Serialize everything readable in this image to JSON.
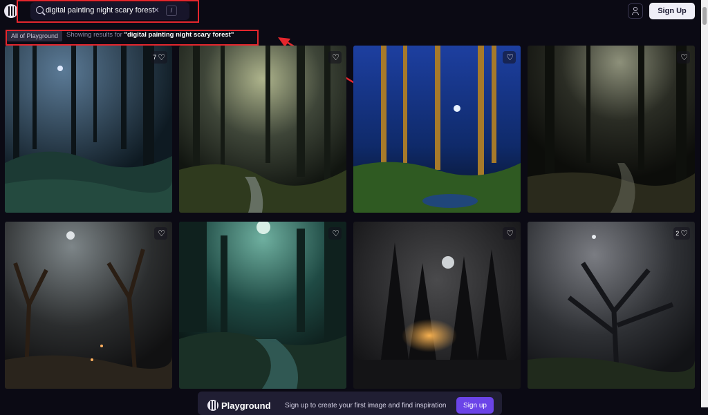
{
  "app": {
    "name": "Playground"
  },
  "search": {
    "query": "digital painting night scary forest",
    "shortcut": "/"
  },
  "header": {
    "signup_label": "Sign Up"
  },
  "filters": {
    "scope_chip": "All of Playground",
    "results_prefix": "Showing results for",
    "results_query": "\"digital painting night scary forest\""
  },
  "grid": {
    "cards": [
      {
        "likes": "7",
        "scene": "forest-moon-blue"
      },
      {
        "likes": "",
        "scene": "forest-misty-stream"
      },
      {
        "likes": "",
        "scene": "forest-blue-night-moon"
      },
      {
        "likes": "",
        "scene": "forest-dark-path"
      },
      {
        "likes": "",
        "scene": "forest-spooky-roots"
      },
      {
        "likes": "",
        "scene": "forest-teal-swamp"
      },
      {
        "likes": "",
        "scene": "forest-moon-glow"
      },
      {
        "likes": "2",
        "scene": "forest-gnarled-tree"
      }
    ]
  },
  "banner": {
    "brand": "Playground",
    "message": "Sign up to create your first image and find inspiration",
    "cta": "Sign up"
  },
  "colors": {
    "annotation": "#e5262d",
    "accent": "#6b44e8",
    "background": "#0b0a14"
  }
}
